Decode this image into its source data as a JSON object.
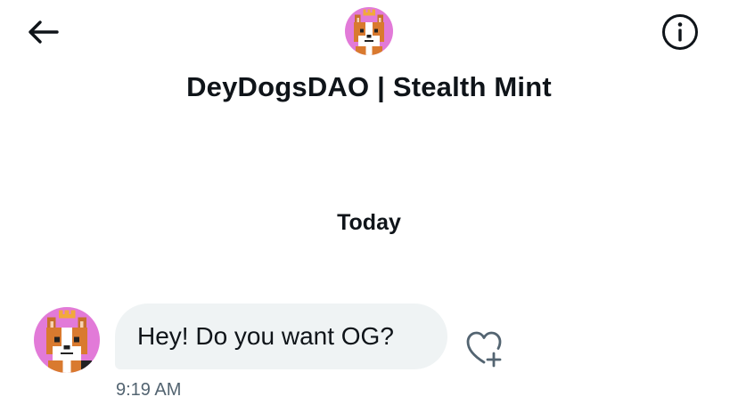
{
  "header": {
    "title": "DeyDogsDAO | Stealth Mint",
    "back_icon": "arrow-left-icon",
    "info_icon": "info-circle-icon"
  },
  "conversation": {
    "date_separator": "Today",
    "messages": [
      {
        "text": "Hey! Do you want OG?",
        "time": "9:19 AM",
        "reaction_icon": "heart-plus-icon"
      }
    ]
  },
  "colors": {
    "text_primary": "#0f1419",
    "text_secondary": "#536471",
    "bubble_bg": "#eff3f4",
    "avatar_bg": "#e27ad8"
  }
}
